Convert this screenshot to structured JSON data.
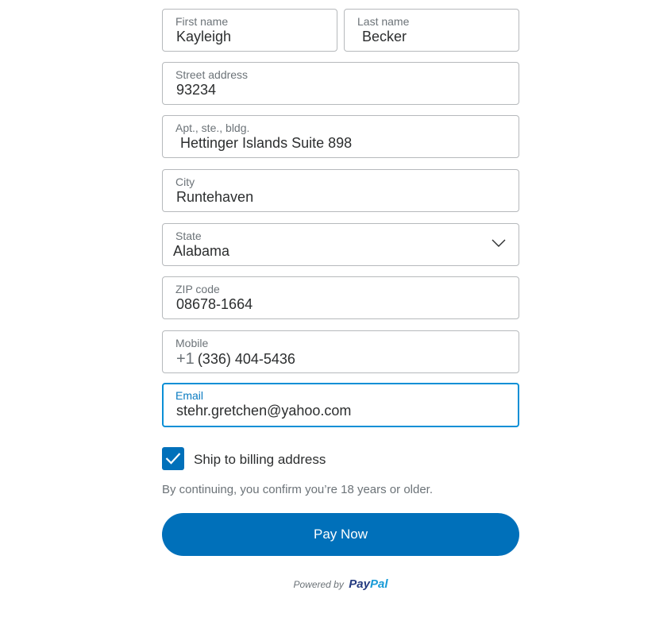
{
  "form": {
    "first_name": {
      "label": "First name",
      "value": "Kayleigh"
    },
    "last_name": {
      "label": "Last name",
      "value": "Becker"
    },
    "street": {
      "label": "Street address",
      "value": "93234"
    },
    "apt": {
      "label": "Apt., ste., bldg.",
      "value": "Hettinger Islands Suite 898"
    },
    "city": {
      "label": "City",
      "value": "Runtehaven"
    },
    "state": {
      "label": "State",
      "value": "Alabama",
      "icon": "chevron-down-icon"
    },
    "zip": {
      "label": "ZIP code",
      "value": "08678-1664"
    },
    "mobile": {
      "label": "Mobile",
      "prefix": "+1",
      "value": "(336) 404-5436"
    },
    "email": {
      "label": "Email",
      "value": "stehr.gretchen@yahoo.com",
      "focused": true
    }
  },
  "ship_to_billing": {
    "label": "Ship to billing address",
    "checked": true
  },
  "legal_text": "By continuing, you confirm you’re 18 years or older.",
  "pay_button": {
    "label": "Pay Now"
  },
  "powered_by": {
    "text": "Powered by",
    "brand_part1": "Pay",
    "brand_part2": "Pal"
  },
  "colors": {
    "primary": "#0070ba",
    "focus_border": "#0a8fd6",
    "brand_dark": "#253b80",
    "brand_light": "#179bd7"
  }
}
